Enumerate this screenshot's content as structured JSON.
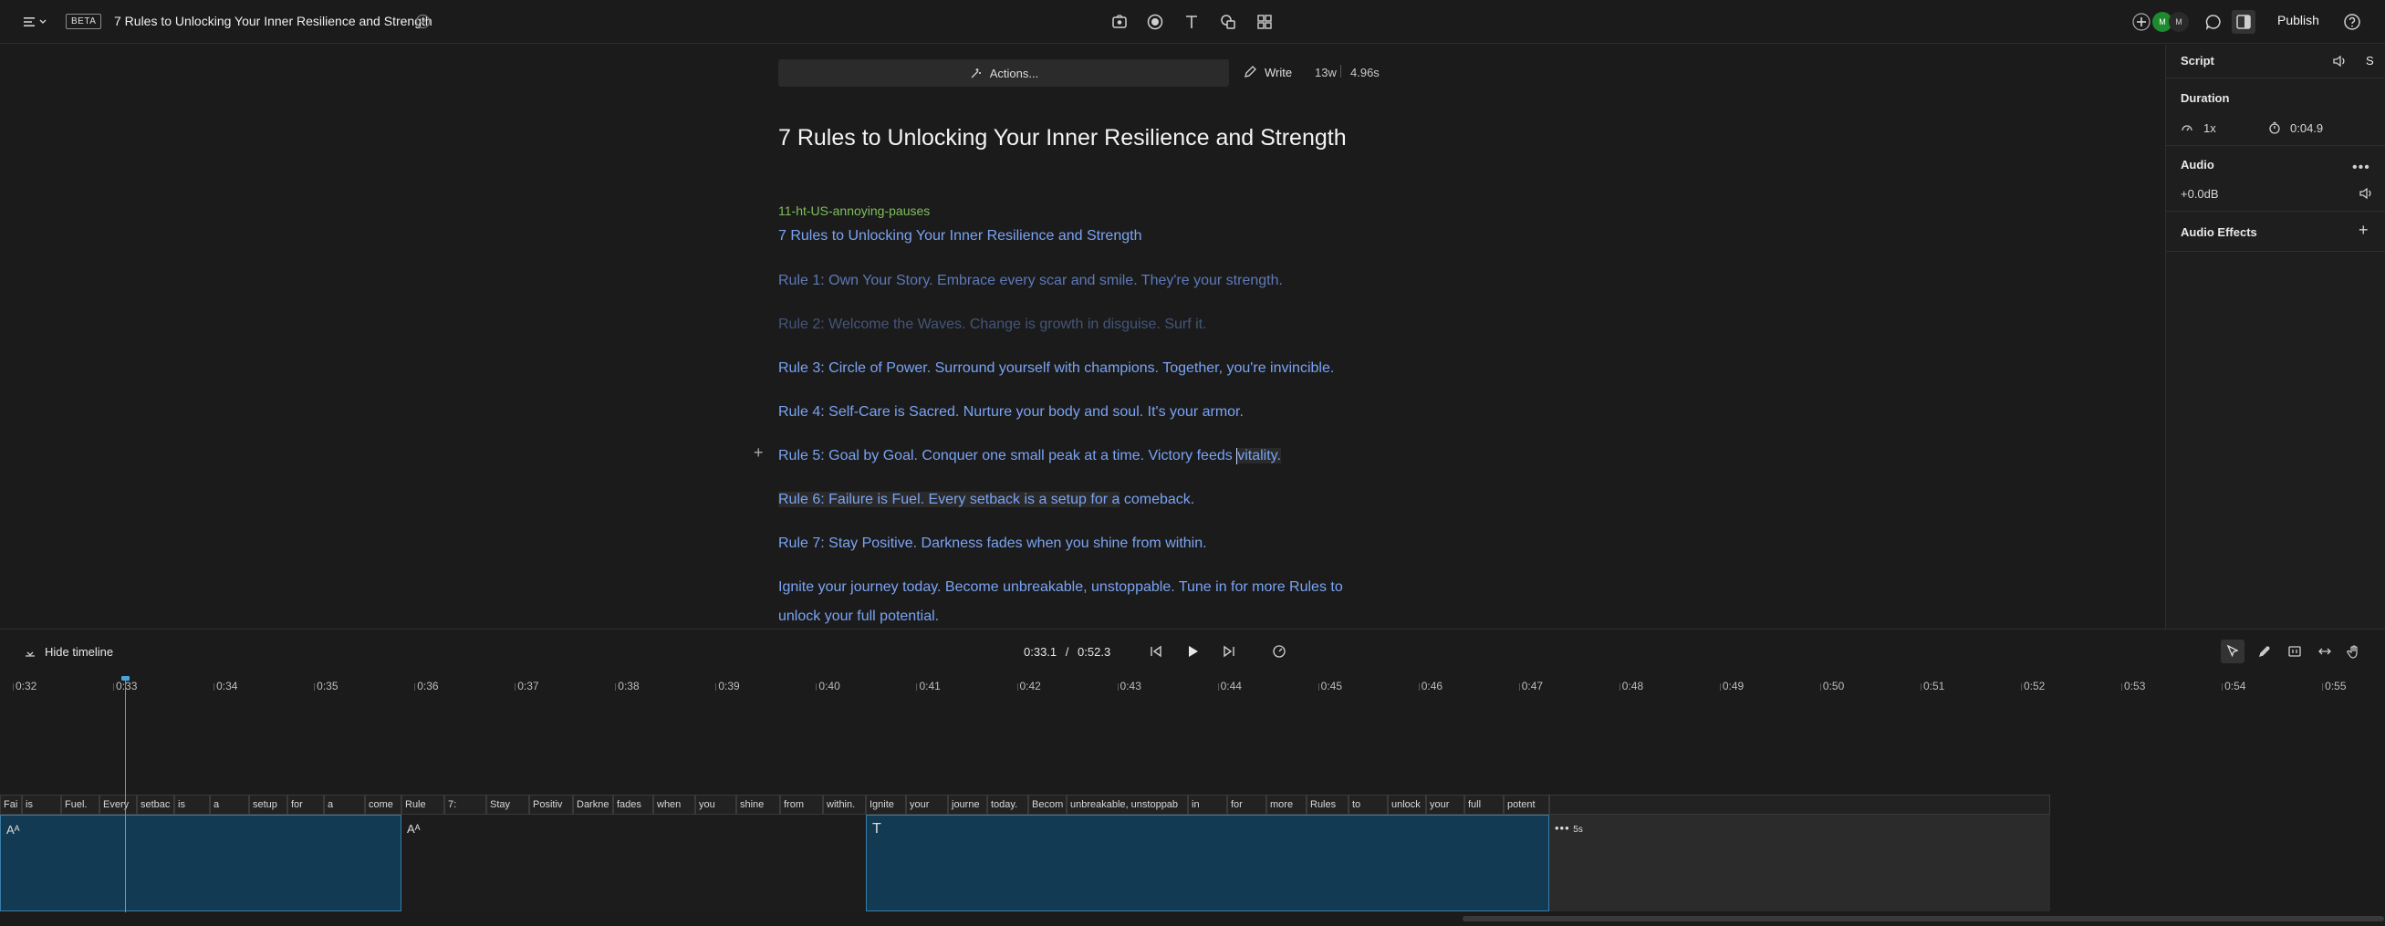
{
  "topbar": {
    "badge": "BETA",
    "title": "7 Rules to Unlocking Your Inner Resilience and Strength",
    "publish_label": "Publish",
    "avatar_initials": "M",
    "avatar_initials_2": "M",
    "colors": {
      "avatar_green": "#1e8a2e"
    }
  },
  "editor": {
    "actions_label": "Actions...",
    "write_label": "Write",
    "word_count": "13w",
    "duration": "4.96s",
    "title": "7 Rules to Unlocking Your Inner Resilience and Strength",
    "speaker": "11-ht-US-annoying-pauses",
    "lines": [
      "7 Rules to Unlocking Your Inner Resilience and Strength",
      "Rule 1: Own Your Story. Embrace every scar and smile. They're your strength.",
      "Rule 2: Welcome the Waves. Change is growth in disguise. Surf it.",
      "Rule 3: Circle of Power. Surround yourself with champions. Together, you're invincible.",
      "Rule 4: Self-Care is Sacred. Nurture your body and soul. It's your armor.",
      "Rule 5: Goal by Goal. Conquer one small peak at a time. Victory feeds",
      "vitality.",
      "Rule 6: Failure is Fuel. Every setback is a setup for a",
      "comeback.",
      "Rule 7: Stay Positive. Darkness fades when you shine from within.",
      "Ignite your journey today. Become unbreakable, unstoppable. Tune in for more Rules to",
      "unlock your full potential."
    ]
  },
  "right_panel": {
    "section_title": "Script",
    "s_label": "S",
    "duration_heading": "Duration",
    "speed": "1x",
    "duration_value": "0:04.9",
    "audio_heading": "Audio",
    "gain": "+0.0dB",
    "effects_heading": "Audio Effects"
  },
  "timeline": {
    "hide_label": "Hide timeline",
    "current_time": "0:33.1",
    "separator": "/",
    "total_time": "0:52.3",
    "ticks": [
      "0:32",
      "0:33",
      "0:34",
      "0:35",
      "0:36",
      "0:37",
      "0:38",
      "0:39",
      "0:40",
      "0:41",
      "0:42",
      "0:43",
      "0:44",
      "0:45",
      "0:46",
      "0:47",
      "0:48",
      "0:49",
      "0:50",
      "0:51",
      "0:52",
      "0:53",
      "0:54",
      "0:55"
    ],
    "words": [
      "Fai",
      "is",
      "Fuel.",
      "Every",
      "setbac",
      "is",
      "a",
      "setup",
      "for",
      "a",
      "come",
      "Rule",
      "7:",
      "Stay",
      "Positiv",
      "Darkne",
      "fades",
      "when",
      "you",
      "shine",
      "from",
      "within.",
      "Ignite",
      "your",
      "journe",
      "today.",
      "Becom",
      "unbreakable, unstoppab",
      "in",
      "for",
      "more",
      "Rules",
      "to",
      "unlock",
      "your",
      "full",
      "potent"
    ],
    "clip_label_a": "Aᴬ",
    "clip_label_b": "Aᴬ",
    "clip_label_c": "T",
    "pause_label": "5s",
    "colors": {
      "clip_fill": "#123a52",
      "clip_border": "#3a7ca8",
      "playhead": "#4aa3df"
    }
  }
}
